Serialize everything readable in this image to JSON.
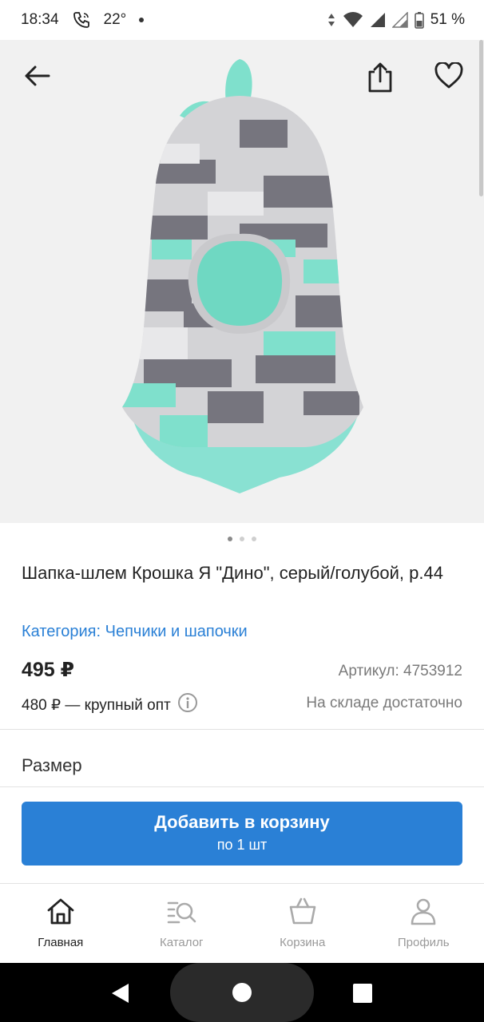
{
  "status_bar": {
    "time": "18:34",
    "temperature": "22°",
    "battery": "51 %"
  },
  "product": {
    "title": "Шапка-шлем Крошка Я \"Дино\", серый/голубой, р.44",
    "category": "Категория: Чепчики и шапочки",
    "price": "495 ₽",
    "sku": "Артикул: 4753912",
    "wholesale": "480 ₽ — крупный опт",
    "stock": "На складе достаточно",
    "size_label": "Размер",
    "image_index": 1,
    "image_count": 3
  },
  "cart_button": {
    "label": "Добавить в корзину",
    "sub_label": "по 1 шт",
    "color": "#2a80d6"
  },
  "bottom_nav": {
    "items": [
      {
        "label": "Главная",
        "icon": "home-icon",
        "active": true
      },
      {
        "label": "Каталог",
        "icon": "catalog-search-icon",
        "active": false
      },
      {
        "label": "Корзина",
        "icon": "basket-icon",
        "active": false
      },
      {
        "label": "Профиль",
        "icon": "user-icon",
        "active": false
      }
    ]
  },
  "colors": {
    "accent": "#2a80d6",
    "hat_gray": "#7b7a84",
    "hat_mint": "#7fe0cc"
  }
}
